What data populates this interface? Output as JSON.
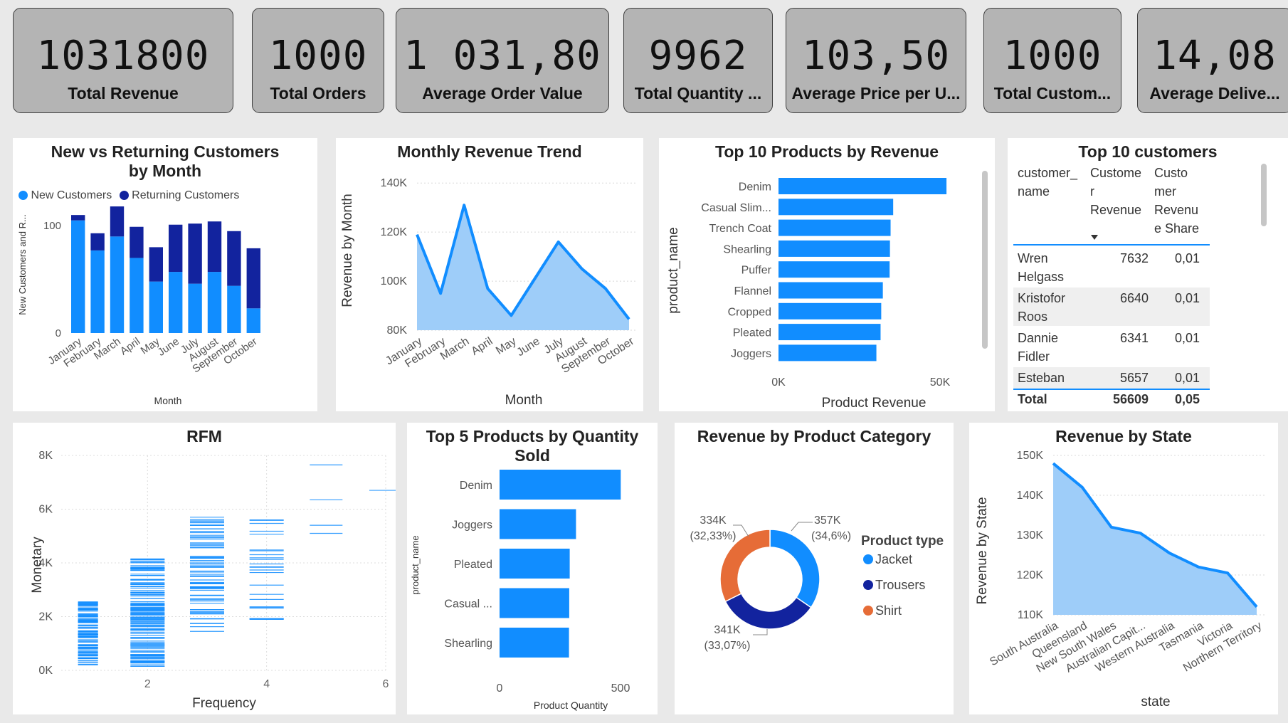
{
  "kpis": [
    {
      "value": "1031800",
      "label": "Total Revenue"
    },
    {
      "value": "1000",
      "label": "Total Orders"
    },
    {
      "value": "1 031,80",
      "label": "Average Order Value"
    },
    {
      "value": "9962",
      "label": "Total Quantity ..."
    },
    {
      "value": "103,50",
      "label": "Average Price per U..."
    },
    {
      "value": "1000",
      "label": "Total Custom..."
    },
    {
      "value": "14,08",
      "label": "Average Delive..."
    }
  ],
  "colors": {
    "primary": "#118DFF",
    "dark": "#12239E",
    "orange": "#E66C37",
    "area": "#9ECDF9",
    "light": "#7CB9F3"
  },
  "chart_data": [
    {
      "type": "bar",
      "id": "customers",
      "title": "New vs Returning Customers by Month",
      "stacked": true,
      "categories": [
        "January",
        "February",
        "March",
        "April",
        "May",
        "June",
        "July",
        "August",
        "September",
        "October"
      ],
      "series": [
        {
          "name": "New Customers",
          "values": [
            105,
            77,
            90,
            70,
            48,
            57,
            46,
            57,
            44,
            23
          ]
        },
        {
          "name": "Returning Customers",
          "values": [
            5,
            16,
            28,
            29,
            32,
            44,
            56,
            47,
            51,
            56
          ]
        }
      ],
      "xlabel": "Month",
      "ylabel": "New Customers and R...",
      "yticks": [
        "0",
        "100"
      ],
      "ylim": [
        0,
        130
      ],
      "legend": "top-left"
    },
    {
      "type": "area",
      "id": "monthly",
      "title": "Monthly Revenue Trend",
      "categories": [
        "January",
        "February",
        "March",
        "April",
        "May",
        "June",
        "July",
        "August",
        "September",
        "October"
      ],
      "values": [
        119000,
        95000,
        131000,
        97000,
        86000,
        101000,
        116000,
        105000,
        97000,
        84500
      ],
      "xlabel": "Month",
      "ylabel": "Revenue by Month",
      "yticks": [
        "80K",
        "100K",
        "120K",
        "140K"
      ],
      "ylim": [
        80000,
        145000
      ]
    },
    {
      "type": "bar",
      "id": "top10",
      "orientation": "horizontal",
      "title": "Top 10 Products by Revenue",
      "categories": [
        "Denim",
        "Casual Slim...",
        "Trench Coat",
        "Shearling",
        "Puffer",
        "Flannel",
        "Cropped",
        "Pleated",
        "Joggers"
      ],
      "values": [
        52000,
        35500,
        34700,
        34500,
        34400,
        32300,
        31800,
        31600,
        30300
      ],
      "xlabel": "Product Revenue",
      "ylabel": "product_name",
      "xticks": [
        "0K",
        "50K"
      ],
      "xlim": [
        0,
        50000
      ]
    },
    {
      "type": "table",
      "id": "customers_table",
      "title": "Top 10 customers",
      "columns": [
        "customer_\nname",
        "Custome\nr\nRevenue",
        "Custo\nmer\nRevenu\ne Share"
      ],
      "rows": [
        [
          "Wren\nHelgass",
          "7632",
          "0,01"
        ],
        [
          "Kristofor\nRoos",
          "6640",
          "0,01"
        ],
        [
          "Dannie\nFidler",
          "6341",
          "0,01"
        ],
        [
          "Esteban",
          "5657",
          "0,01"
        ]
      ],
      "total": [
        "Total",
        "56609",
        "0,05"
      ]
    },
    {
      "type": "scatter",
      "id": "rfm",
      "title": "RFM",
      "xlabel": "Frequency",
      "ylabel": "Monetary",
      "xlim": [
        0,
        6
      ],
      "ylim": [
        0,
        8000
      ],
      "xticks": [
        "2",
        "4",
        "6"
      ],
      "yticks": [
        "0K",
        "2K",
        "4K",
        "6K",
        "8K"
      ],
      "groups": [
        {
          "x": 1,
          "min": 200,
          "max": 2550,
          "count": 110
        },
        {
          "x": 2,
          "min": 150,
          "max": 4150,
          "count": 130
        },
        {
          "x": 3,
          "min": 1450,
          "max": 5700,
          "count": 75
        },
        {
          "x": 4,
          "min": 1900,
          "max": 5600,
          "count": 25
        },
        {
          "x": 5,
          "values": [
            5100,
            5400,
            6350,
            7650
          ]
        },
        {
          "x": 6,
          "values": [
            6700
          ]
        }
      ]
    },
    {
      "type": "bar",
      "id": "top5",
      "orientation": "horizontal",
      "title": "Top 5 Products by Quantity Sold",
      "categories": [
        "Denim",
        "Joggers",
        "Pleated",
        "Casual ...",
        "Shearling"
      ],
      "values": [
        501,
        316,
        290,
        288,
        287
      ],
      "xlabel": "Product Quantity",
      "ylabel": "product_name",
      "xticks": [
        "0",
        "500"
      ],
      "xlim": [
        0,
        500
      ]
    },
    {
      "type": "pie",
      "id": "category",
      "title": "Revenue by Product Category",
      "donut": true,
      "slices": [
        {
          "name": "Jacket",
          "value": 357,
          "label": "357K",
          "pct": "(34,6%)"
        },
        {
          "name": "Trousers",
          "value": 341,
          "label": "341K",
          "pct": "(33,07%)"
        },
        {
          "name": "Shirt",
          "value": 334,
          "label": "334K",
          "pct": "(32,33%)"
        }
      ],
      "legend_title": "Product type",
      "legend": "right"
    },
    {
      "type": "area",
      "id": "state",
      "title": "Revenue by State",
      "categories": [
        "South Australia",
        "Queensland",
        "New South Wales",
        "Australian Capit...",
        "Western Australia",
        "Tasmania",
        "Victoria",
        "Northern Territory"
      ],
      "values": [
        148000,
        142000,
        132000,
        130500,
        125500,
        122000,
        120500,
        112000
      ],
      "xlabel": "state",
      "ylabel": "Revenue by State",
      "yticks": [
        "110K",
        "120K",
        "130K",
        "140K",
        "150K"
      ],
      "ylim": [
        110000,
        150000
      ]
    }
  ]
}
